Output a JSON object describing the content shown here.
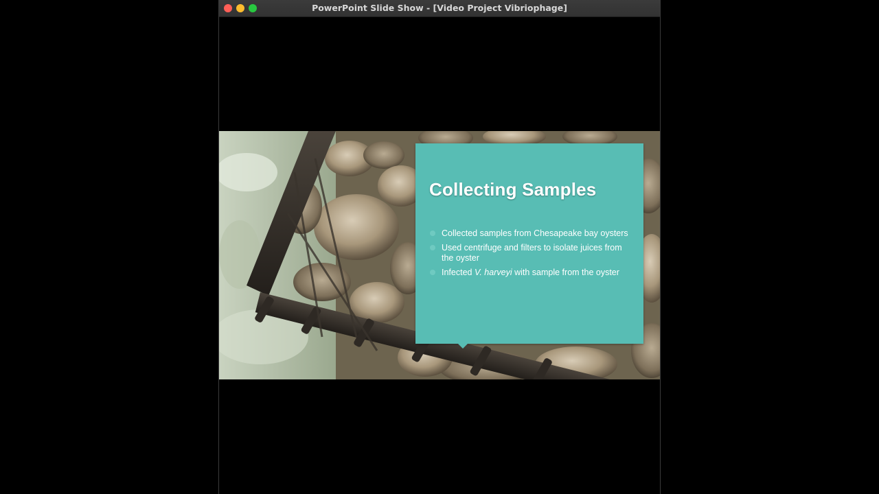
{
  "window": {
    "title": "PowerPoint Slide Show - [Video Project Vibriophage]"
  },
  "slide": {
    "title": "Collecting Samples",
    "bullets": [
      {
        "text": "Collected samples from Chesapeake bay oysters"
      },
      {
        "text": "Used centrifuge and filters to isolate juices from the oyster"
      },
      {
        "pre": "Infected ",
        "em": "V. harveyi",
        "post": " with sample from the oyster"
      }
    ],
    "background_image": "oyster-dredge-photo"
  },
  "colors": {
    "panel": "#58bdb4",
    "bullet": "#6fcac1",
    "titlebar": "#3b3b3b"
  }
}
